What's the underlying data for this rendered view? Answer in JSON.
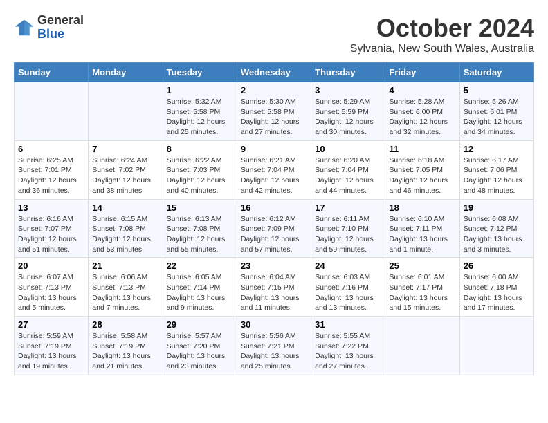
{
  "header": {
    "logo": {
      "general": "General",
      "blue": "Blue"
    },
    "title": "October 2024",
    "location": "Sylvania, New South Wales, Australia"
  },
  "weekdays": [
    "Sunday",
    "Monday",
    "Tuesday",
    "Wednesday",
    "Thursday",
    "Friday",
    "Saturday"
  ],
  "weeks": [
    [
      {
        "day": "",
        "info": ""
      },
      {
        "day": "",
        "info": ""
      },
      {
        "day": "1",
        "info": "Sunrise: 5:32 AM\nSunset: 5:58 PM\nDaylight: 12 hours\nand 25 minutes."
      },
      {
        "day": "2",
        "info": "Sunrise: 5:30 AM\nSunset: 5:58 PM\nDaylight: 12 hours\nand 27 minutes."
      },
      {
        "day": "3",
        "info": "Sunrise: 5:29 AM\nSunset: 5:59 PM\nDaylight: 12 hours\nand 30 minutes."
      },
      {
        "day": "4",
        "info": "Sunrise: 5:28 AM\nSunset: 6:00 PM\nDaylight: 12 hours\nand 32 minutes."
      },
      {
        "day": "5",
        "info": "Sunrise: 5:26 AM\nSunset: 6:01 PM\nDaylight: 12 hours\nand 34 minutes."
      }
    ],
    [
      {
        "day": "6",
        "info": "Sunrise: 6:25 AM\nSunset: 7:01 PM\nDaylight: 12 hours\nand 36 minutes."
      },
      {
        "day": "7",
        "info": "Sunrise: 6:24 AM\nSunset: 7:02 PM\nDaylight: 12 hours\nand 38 minutes."
      },
      {
        "day": "8",
        "info": "Sunrise: 6:22 AM\nSunset: 7:03 PM\nDaylight: 12 hours\nand 40 minutes."
      },
      {
        "day": "9",
        "info": "Sunrise: 6:21 AM\nSunset: 7:04 PM\nDaylight: 12 hours\nand 42 minutes."
      },
      {
        "day": "10",
        "info": "Sunrise: 6:20 AM\nSunset: 7:04 PM\nDaylight: 12 hours\nand 44 minutes."
      },
      {
        "day": "11",
        "info": "Sunrise: 6:18 AM\nSunset: 7:05 PM\nDaylight: 12 hours\nand 46 minutes."
      },
      {
        "day": "12",
        "info": "Sunrise: 6:17 AM\nSunset: 7:06 PM\nDaylight: 12 hours\nand 48 minutes."
      }
    ],
    [
      {
        "day": "13",
        "info": "Sunrise: 6:16 AM\nSunset: 7:07 PM\nDaylight: 12 hours\nand 51 minutes."
      },
      {
        "day": "14",
        "info": "Sunrise: 6:15 AM\nSunset: 7:08 PM\nDaylight: 12 hours\nand 53 minutes."
      },
      {
        "day": "15",
        "info": "Sunrise: 6:13 AM\nSunset: 7:08 PM\nDaylight: 12 hours\nand 55 minutes."
      },
      {
        "day": "16",
        "info": "Sunrise: 6:12 AM\nSunset: 7:09 PM\nDaylight: 12 hours\nand 57 minutes."
      },
      {
        "day": "17",
        "info": "Sunrise: 6:11 AM\nSunset: 7:10 PM\nDaylight: 12 hours\nand 59 minutes."
      },
      {
        "day": "18",
        "info": "Sunrise: 6:10 AM\nSunset: 7:11 PM\nDaylight: 13 hours\nand 1 minute."
      },
      {
        "day": "19",
        "info": "Sunrise: 6:08 AM\nSunset: 7:12 PM\nDaylight: 13 hours\nand 3 minutes."
      }
    ],
    [
      {
        "day": "20",
        "info": "Sunrise: 6:07 AM\nSunset: 7:13 PM\nDaylight: 13 hours\nand 5 minutes."
      },
      {
        "day": "21",
        "info": "Sunrise: 6:06 AM\nSunset: 7:13 PM\nDaylight: 13 hours\nand 7 minutes."
      },
      {
        "day": "22",
        "info": "Sunrise: 6:05 AM\nSunset: 7:14 PM\nDaylight: 13 hours\nand 9 minutes."
      },
      {
        "day": "23",
        "info": "Sunrise: 6:04 AM\nSunset: 7:15 PM\nDaylight: 13 hours\nand 11 minutes."
      },
      {
        "day": "24",
        "info": "Sunrise: 6:03 AM\nSunset: 7:16 PM\nDaylight: 13 hours\nand 13 minutes."
      },
      {
        "day": "25",
        "info": "Sunrise: 6:01 AM\nSunset: 7:17 PM\nDaylight: 13 hours\nand 15 minutes."
      },
      {
        "day": "26",
        "info": "Sunrise: 6:00 AM\nSunset: 7:18 PM\nDaylight: 13 hours\nand 17 minutes."
      }
    ],
    [
      {
        "day": "27",
        "info": "Sunrise: 5:59 AM\nSunset: 7:19 PM\nDaylight: 13 hours\nand 19 minutes."
      },
      {
        "day": "28",
        "info": "Sunrise: 5:58 AM\nSunset: 7:19 PM\nDaylight: 13 hours\nand 21 minutes."
      },
      {
        "day": "29",
        "info": "Sunrise: 5:57 AM\nSunset: 7:20 PM\nDaylight: 13 hours\nand 23 minutes."
      },
      {
        "day": "30",
        "info": "Sunrise: 5:56 AM\nSunset: 7:21 PM\nDaylight: 13 hours\nand 25 minutes."
      },
      {
        "day": "31",
        "info": "Sunrise: 5:55 AM\nSunset: 7:22 PM\nDaylight: 13 hours\nand 27 minutes."
      },
      {
        "day": "",
        "info": ""
      },
      {
        "day": "",
        "info": ""
      }
    ]
  ]
}
